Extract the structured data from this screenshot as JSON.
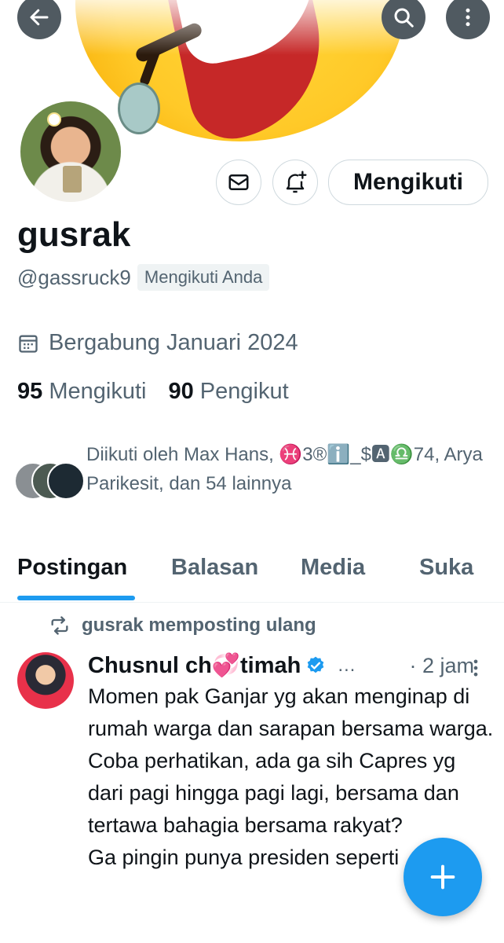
{
  "header": {
    "back_icon": "arrow-left-icon",
    "search_icon": "search-icon",
    "more_icon": "more-vertical-icon"
  },
  "profile": {
    "name": "gusrak",
    "handle": "@gassruck9",
    "follows_you": "Mengikuti Anda",
    "joined": "Bergabung Januari 2024",
    "following_count": "95",
    "following_label": "Mengikuti",
    "followers_count": "90",
    "followers_label": "Pengikut",
    "followed_by": "Diikuti oleh Max Hans, ♓3®ℹ️_$🅰♎74, Arya Parikesit, dan 54 lainnya"
  },
  "actions": {
    "message_icon": "envelope-icon",
    "notify_icon": "bell-plus-icon",
    "follow_label": "Mengikuti"
  },
  "tabs": [
    "Postingan",
    "Balasan",
    "Media",
    "Suka"
  ],
  "post": {
    "repost_label": "gusrak memposting ulang",
    "author": "Chusnul ch💞timah",
    "verified_icon": "verified-badge-icon",
    "ellipsis": "…",
    "time": "· 2 jam",
    "text": "Momen pak Ganjar yg akan menginap di rumah warga dan sarapan bersama warga.\nCoba perhatikan, ada ga sih Capres yg dari pagi hingga pagi lagi, bersama dan tertawa bahagia bersama rakyat?\nGa pingin punya presiden seperti"
  },
  "colors": {
    "accent": "#1d9bf0",
    "text_primary": "#0f1419",
    "text_secondary": "#536471"
  },
  "fab_icon": "plus-icon"
}
